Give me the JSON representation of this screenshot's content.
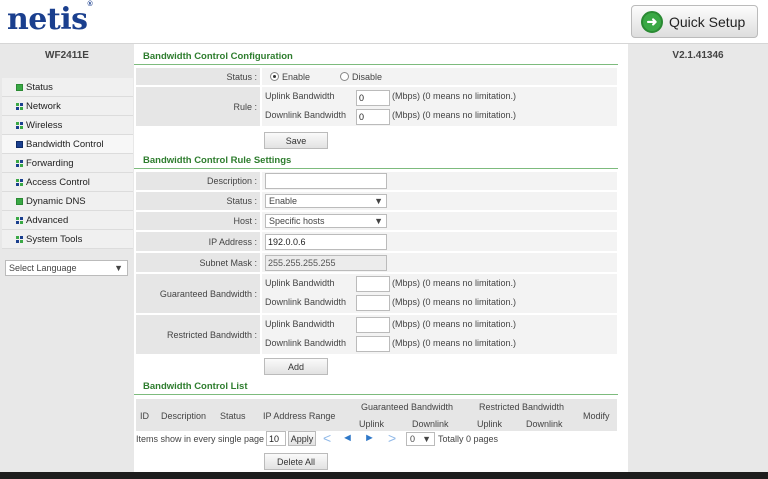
{
  "brand": {
    "logo": "netis",
    "reg": "®"
  },
  "header": {
    "quick_setup": "Quick Setup"
  },
  "left": {
    "model": "WF2411E",
    "menu": [
      {
        "label": "Status",
        "icon": "green"
      },
      {
        "label": "Network",
        "icon": "grid"
      },
      {
        "label": "Wireless",
        "icon": "grid"
      },
      {
        "label": "Bandwidth Control",
        "icon": "dark"
      },
      {
        "label": "Forwarding",
        "icon": "grid"
      },
      {
        "label": "Access Control",
        "icon": "grid"
      },
      {
        "label": "Dynamic DNS",
        "icon": "green"
      },
      {
        "label": "Advanced",
        "icon": "grid"
      },
      {
        "label": "System Tools",
        "icon": "grid"
      }
    ],
    "language": "Select Language"
  },
  "right": {
    "version": "V2.1.41346"
  },
  "config": {
    "title": "Bandwidth Control Configuration",
    "status_label": "Status :",
    "enable": "Enable",
    "disable": "Disable",
    "rule_label": "Rule :",
    "uplink_label": "Uplink Bandwidth",
    "downlink_label": "Downlink Bandwidth",
    "uplink_value": "0",
    "downlink_value": "0",
    "unit_note": "(Mbps) (0 means no limitation.)",
    "save": "Save"
  },
  "rules": {
    "title": "Bandwidth Control Rule Settings",
    "description_label": "Description :",
    "description_value": "",
    "status_label": "Status :",
    "status_value": "Enable",
    "host_label": "Host :",
    "host_value": "Specific hosts",
    "ip_label": "IP Address :",
    "ip_value": "192.0.0.6",
    "mask_label": "Subnet Mask :",
    "mask_value": "255.255.255.255",
    "guaranteed_label": "Guaranteed Bandwidth :",
    "restricted_label": "Restricted Bandwidth :",
    "uplink_label": "Uplink Bandwidth",
    "downlink_label": "Downlink Bandwidth",
    "unit_note": "(Mbps) (0 means no limitation.)",
    "add": "Add"
  },
  "list": {
    "title": "Bandwidth Control List",
    "headers": {
      "id": "ID",
      "description": "Description",
      "status": "Status",
      "ip_range": "IP Address Range",
      "guaranteed": "Guaranteed Bandwidth",
      "restricted": "Restricted Bandwidth",
      "uplink": "Uplink",
      "downlink": "Downlink",
      "modify": "Modify"
    },
    "items_label": "Items show in every single page",
    "items_value": "10",
    "apply": "Apply",
    "page_value": "0",
    "total": "Totally 0 pages",
    "delete_all": "Delete All"
  }
}
